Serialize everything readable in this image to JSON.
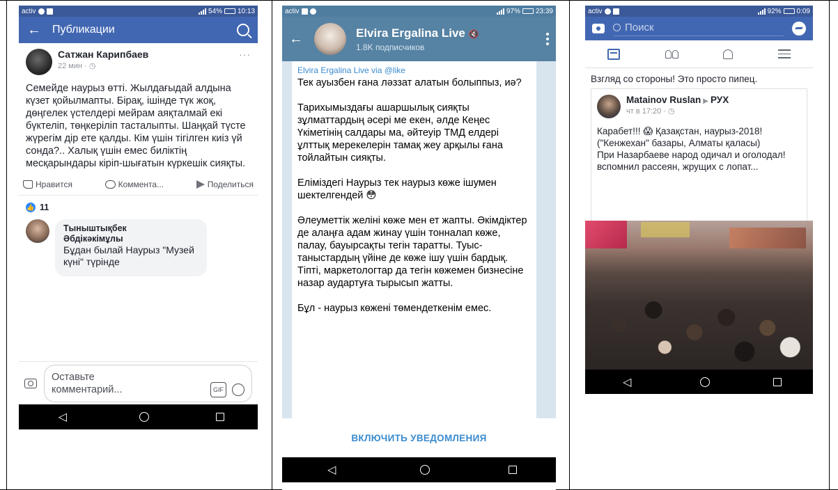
{
  "panel1": {
    "status": {
      "carrier": "activ",
      "battery": "54%",
      "time": "10:13"
    },
    "header": {
      "title": "Публикации"
    },
    "post": {
      "author": "Сатжан Карипбаев",
      "time": "22 мин · ",
      "text": "Семейде наурыз өтті. Жылдағыдай алдына күзет қойылмапты. Бірақ, ішінде түк жоқ, дөңгелек үстелдері мейрам аяқталмай екі бүктеліп, төңкеріліп тасталыпты. Шаңқай түсте жүрегім дір ете қалды. Кім үшін тігілген киіз үй сонда?.. Халық үшін емес биліктің месқарындары кіріп-шығатын күркешік сияқты."
    },
    "actions": {
      "like": "Нравится",
      "comment": "Коммента...",
      "share": "Поделиться"
    },
    "reactions_count": "11",
    "comment": {
      "author_line1": "Тыныштықбек",
      "author_line2": "Әбдікәкімұлы",
      "text": "Бұдан былай Наурыз \"Музей күні\" түрінде"
    },
    "composer": {
      "placeholder_line1": "Оставьте",
      "placeholder_line2": "комментарий...",
      "gif": "GIF"
    }
  },
  "panel2": {
    "status": {
      "carrier": "activ",
      "battery": "97%",
      "time": "23:39"
    },
    "channel": {
      "name": "Elvira Ergalina Live",
      "subscribers": "1.8K подписчиков"
    },
    "message": {
      "via_name": "Elvira Ergalina Live",
      "via_word": " via ",
      "via_bot": "@like",
      "paragraphs": [
        "Тек ауызбен ғана ләззат алатын болыппыз, иә?",
        "Тарихымыздағы ашаршылық сияқты зұлматтардың әсері ме екен, әлде Кеңес Үкіметінің салдары ма, әйтеуір ТМД елдері ұлттық мерекелерін тамақ жеу арқылы ғана тойлайтын сияқты.",
        "Еліміздегі Наурыз тек наурыз көже ішумен шектелгендей 😳",
        "Әлеуметтік желіні көже мен ет жапты. Әкімдіктер де алаңға адам жинау үшін тонналап көже, палау, бауырсақты тегін таратты. Туыс-таныстардың үйіне де көже ішу үшін бардық. Тіпті, маркетологтар да тегін көжемен бизнесіне назар аудартуға тырысып жатты.",
        "Бұл - наурыз көжені төмендеткенім емес."
      ]
    },
    "notify_button": "ВКЛЮЧИТЬ УВЕДОМЛЕНИЯ"
  },
  "panel3": {
    "status": {
      "carrier": "activ",
      "battery": "92%",
      "time": "0:09"
    },
    "search_placeholder": "Поиск",
    "share_caption": "Взгляд со стороны! Это просто пипец.",
    "shared": {
      "author": "Matainov Ruslan",
      "arrow": "▶",
      "target": "РУХ",
      "time": "чт в 17:20 · ",
      "text_lines": [
        "Карабет!!! 😱 Қазақстан, наурыз-2018! (\"Кенжехан\" базары, Алматы қаласы)",
        "При Назарбаеве народ одичал и оголодал! вспомнил рассеян, жрущих с лопат..."
      ]
    }
  },
  "colors": {
    "fb_blue": "#4267b2",
    "telegram_header": "#5682a3",
    "telegram_link": "#3a8bcf",
    "like_blue": "#2d88ff"
  }
}
